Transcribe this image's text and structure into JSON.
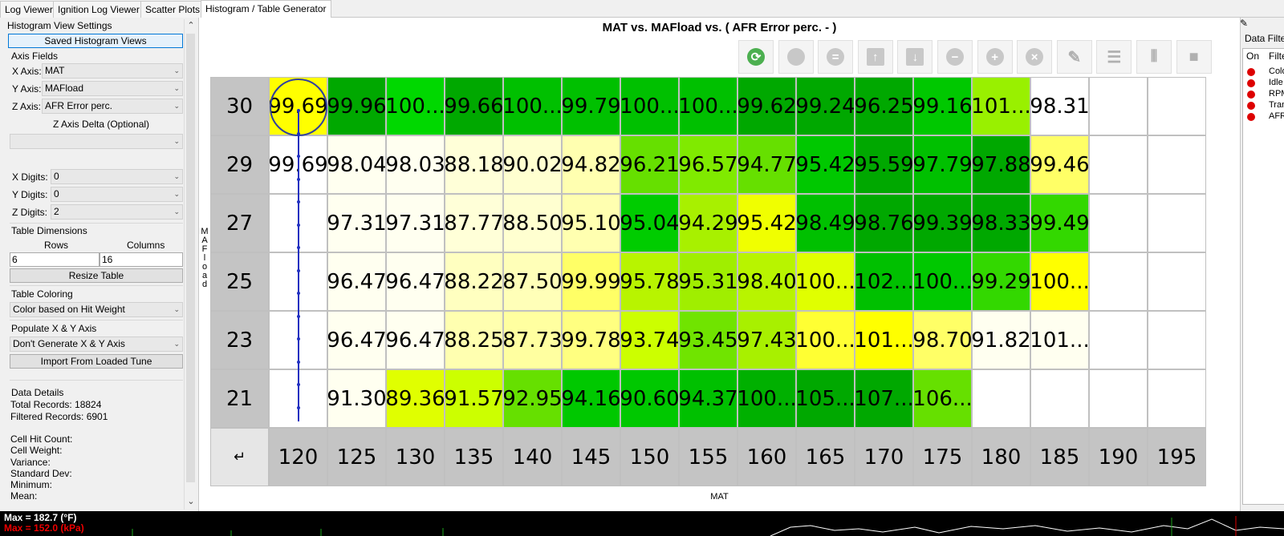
{
  "tabs": [
    "Log Viewer",
    "Ignition Log Viewer",
    "Scatter Plots",
    "Histogram / Table Generator"
  ],
  "left_panel": {
    "header": "Histogram View Settings",
    "saved_views_button": "Saved Histogram Views",
    "axis_fields_label": "Axis Fields",
    "x_axis_label": "X Axis:",
    "x_axis_value": "MAT",
    "y_axis_label": "Y Axis:",
    "y_axis_value": "MAFload",
    "z_axis_label": "Z Axis:",
    "z_axis_value": "AFR Error perc.",
    "z_delta_label": "Z Axis Delta (Optional)",
    "z_delta_value": "",
    "x_digits_label": "X Digits:",
    "x_digits_value": "0",
    "y_digits_label": "Y Digits:",
    "y_digits_value": "0",
    "z_digits_label": "Z Digits:",
    "z_digits_value": "2",
    "table_dimensions_label": "Table Dimensions",
    "rows_label": "Rows",
    "rows_value": "6",
    "columns_label": "Columns",
    "columns_value": "16",
    "resize_button": "Resize Table",
    "table_coloring_label": "Table Coloring",
    "table_coloring_value": "Color based on Hit Weight",
    "populate_label": "Populate X & Y Axis",
    "populate_value": "Don't Generate X & Y Axis",
    "import_button": "Import From Loaded Tune",
    "data_details_label": "Data Details",
    "total_records": "Total Records: 18824",
    "filtered_records": "Filtered Records: 6901",
    "cell_hit_count": "Cell Hit Count:",
    "cell_weight": "Cell Weight:",
    "variance": "Variance:",
    "std_dev": "Standard Dev:",
    "minimum": "Minimum:",
    "mean": "Mean:"
  },
  "main": {
    "title": "MAT vs. MAFload vs. ( AFR Error perc. -   )",
    "y_axis_title": "MAFload",
    "x_axis_title": "MAT",
    "corner_icon": "↵",
    "toolbar_icons": [
      "refresh-icon",
      "circle-icon",
      "equals-icon",
      "move-up-icon",
      "move-down-icon",
      "minus-icon",
      "plus-icon",
      "clear-icon",
      "edit-icon",
      "rows-icon",
      "columns-icon",
      "square-icon"
    ],
    "table": {
      "row_headers": [
        "30",
        "29",
        "27",
        "25",
        "23",
        "21"
      ],
      "col_headers": [
        "120",
        "125",
        "130",
        "135",
        "140",
        "145",
        "150",
        "155",
        "160",
        "165",
        "170",
        "175",
        "180",
        "185",
        "190",
        "195"
      ],
      "cells": [
        [
          "99.69",
          "99.96",
          "100...",
          "99.66",
          "100...",
          "99.79",
          "100...",
          "100...",
          "99.62",
          "99.24",
          "96.25",
          "99.16",
          "101...",
          "98.31",
          "",
          ""
        ],
        [
          "99.69",
          "98.04",
          "98.03",
          "88.18",
          "90.02",
          "94.82",
          "96.21",
          "96.57",
          "94.77",
          "95.42",
          "95.59",
          "97.79",
          "97.88",
          "99.46",
          "",
          ""
        ],
        [
          "",
          "97.31",
          "97.31",
          "87.77",
          "88.50",
          "95.10",
          "95.04",
          "94.29",
          "95.42",
          "98.49",
          "98.76",
          "99.39",
          "98.33",
          "99.49",
          "",
          ""
        ],
        [
          "",
          "96.47",
          "96.47",
          "88.22",
          "87.50",
          "99.99",
          "95.78",
          "95.31",
          "98.40",
          "100...",
          "102...",
          "100...",
          "99.29",
          "100...",
          "",
          ""
        ],
        [
          "",
          "96.47",
          "96.47",
          "88.25",
          "87.73",
          "99.78",
          "93.74",
          "93.45",
          "97.43",
          "100...",
          "101...",
          "98.70",
          "91.82",
          "101...",
          "",
          ""
        ],
        [
          "",
          "91.30",
          "89.36",
          "91.57",
          "92.95",
          "94.16",
          "90.60",
          "94.37",
          "100...",
          "105...",
          "107...",
          "106...",
          "",
          "",
          "",
          ""
        ]
      ],
      "colors": [
        [
          "#ffff00",
          "#00a800",
          "#00d800",
          "#00a800",
          "#00c000",
          "#00c000",
          "#00c000",
          "#00c000",
          "#00a800",
          "#00a800",
          "#00a800",
          "#00c800",
          "#99f000",
          "#ffffff",
          "#ffffff",
          "#ffffff"
        ],
        [
          "#ffffff",
          "#fffff0",
          "#fffff0",
          "#ffffd8",
          "#ffffd0",
          "#ffffb0",
          "#66e000",
          "#80ea00",
          "#66e000",
          "#00c800",
          "#00a800",
          "#00c000",
          "#00a800",
          "#ffff66",
          "#ffffff",
          "#ffffff"
        ],
        [
          "#ffffff",
          "#fffff0",
          "#fffff0",
          "#ffffd8",
          "#ffffd0",
          "#ffffb0",
          "#00cc00",
          "#a8f000",
          "#f0ff00",
          "#00c000",
          "#00a800",
          "#00a800",
          "#00a800",
          "#33d800",
          "#ffffff",
          "#ffffff"
        ],
        [
          "#ffffff",
          "#fffff0",
          "#fffff0",
          "#ffffc0",
          "#ffffb8",
          "#ffff66",
          "#b8f400",
          "#a0ee00",
          "#b8f400",
          "#e0ff00",
          "#00c000",
          "#00c800",
          "#33d800",
          "#ffff00",
          "#ffffff",
          "#ffffff"
        ],
        [
          "#ffffff",
          "#fffff0",
          "#fffff0",
          "#ffffb0",
          "#ffffa0",
          "#ffff80",
          "#ccff00",
          "#70e400",
          "#a8f000",
          "#ffff33",
          "#ffff00",
          "#ffff66",
          "#fffff0",
          "#fffff0",
          "#ffffff",
          "#ffffff"
        ],
        [
          "#ffffff",
          "#fffff0",
          "#e0ff00",
          "#ccff00",
          "#66e000",
          "#00c800",
          "#00c800",
          "#00c000",
          "#00b000",
          "#00a800",
          "#00a800",
          "#66e000",
          "#ffffff",
          "#ffffff",
          "#ffffff",
          "#ffffff"
        ]
      ]
    }
  },
  "right_panel": {
    "title": "Data Filters",
    "col_on": "On",
    "col_filter": "Filter",
    "filters": [
      "Cold",
      "Idle",
      "RPM",
      "Trans",
      "AFR"
    ]
  },
  "bottom": {
    "line1": "Max = 182.7 (°F)",
    "line2": "Max = 152.0 (kPa)"
  }
}
